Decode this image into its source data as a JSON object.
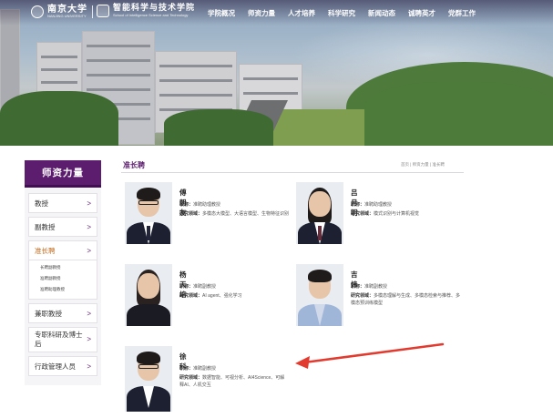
{
  "header": {
    "logo_primary": "南京大学",
    "logo_primary_en": "NANJING UNIVERSITY",
    "logo_school": "智能科学与技术学院",
    "logo_school_en": "School of Intelligence Science and Technology",
    "nav": [
      "学院概况",
      "师资力量",
      "人才培养",
      "科学研究",
      "新闻动态",
      "诚聘英才",
      "党群工作"
    ]
  },
  "sidebar": {
    "title": "师资力量",
    "items": [
      {
        "label": "教授",
        "chevron": ">"
      },
      {
        "label": "副教授",
        "chevron": ">"
      },
      {
        "label": "准长聘",
        "chevron": ">",
        "active": true,
        "subitems": [
          "长聘副教授",
          "准聘副教授",
          "准聘助理教授"
        ]
      },
      {
        "label": "兼职教授",
        "chevron": ">"
      },
      {
        "label": "专职科研及博士后",
        "chevron": ">"
      },
      {
        "label": "行政管理人员",
        "chevron": ">"
      }
    ]
  },
  "main": {
    "title": "准长聘",
    "breadcrumb": "首页 | 师资力量 | 准长聘",
    "title_label": "职称：",
    "field_label": "研究领域：",
    "people": [
      {
        "name": "傅朝友",
        "title": "准聘助理教授",
        "field": "多模态大模型、大语言模型、生物特征识别"
      },
      {
        "name": "吕月明",
        "title": "准聘助理教授",
        "field": "模式识别与计算机视觉"
      },
      {
        "name": "杨天培",
        "title": "准聘副教授",
        "field": "AI agent、强化学习"
      },
      {
        "name": "吉炜",
        "title": "准聘副教授",
        "field": "多模态理解与生成、多模态检索与推荐、多模态预训练模型"
      },
      {
        "name": "徐科",
        "title": "准聘副教授",
        "field": "数据智能、可视分析、AI4Science、可解释AI、人机交互"
      }
    ]
  },
  "colors": {
    "brand_purple": "#5c1d6e",
    "active_orange": "#c26a1c",
    "annotation_red": "#e23a2e"
  }
}
